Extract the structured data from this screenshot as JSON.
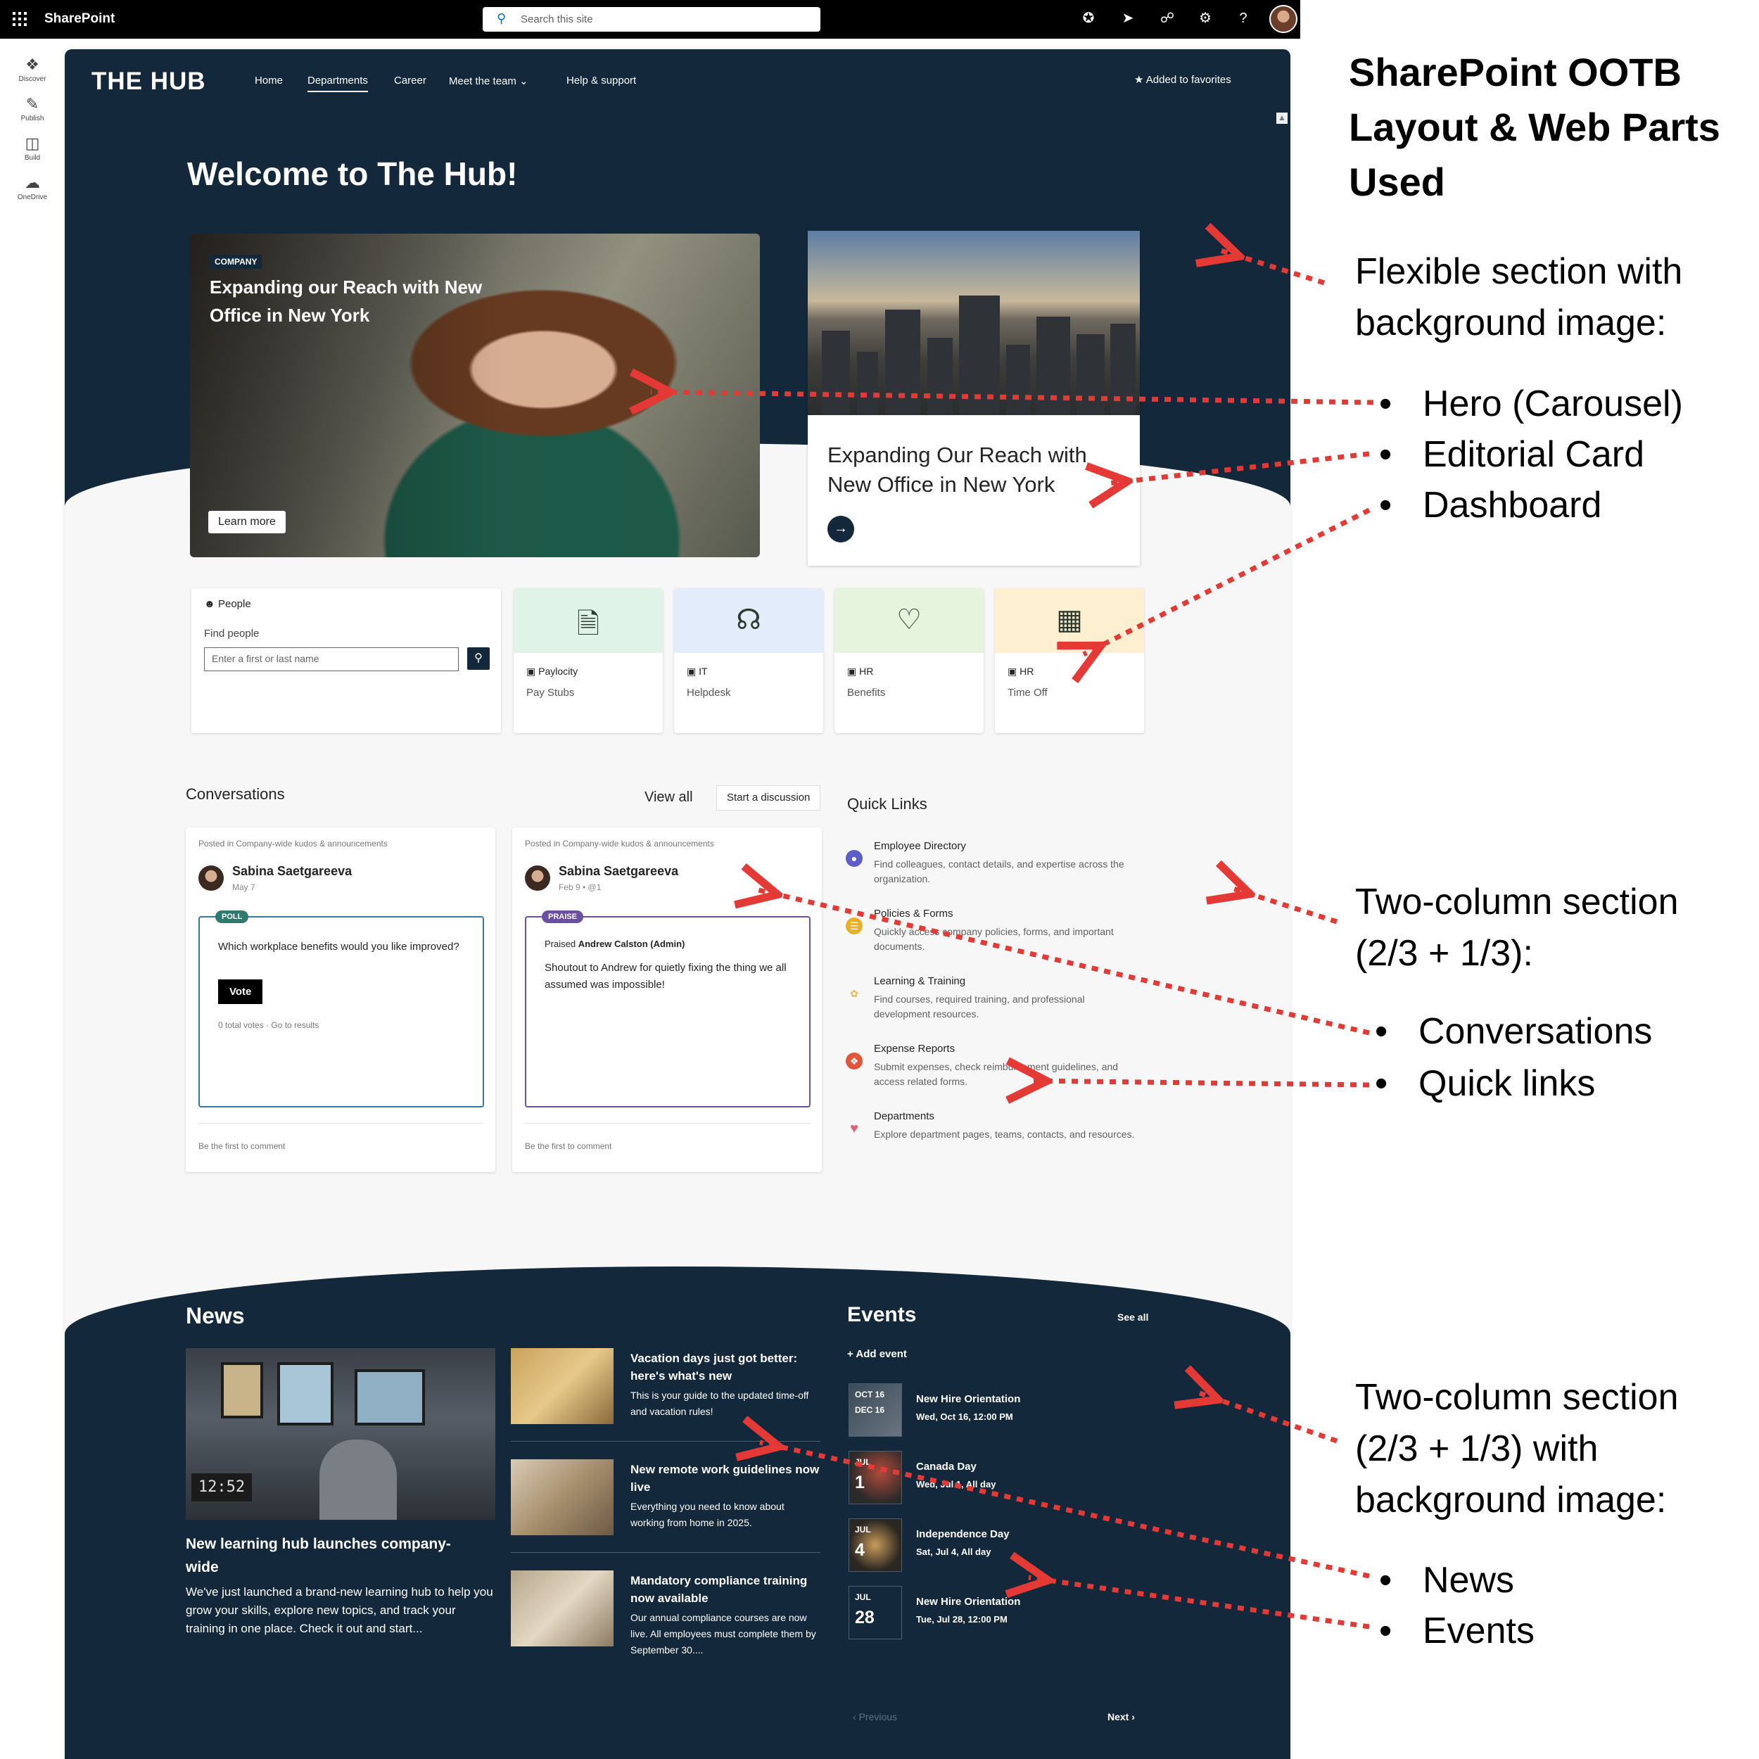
{
  "suitebar": {
    "app_name": "SharePoint",
    "search_placeholder": "Search this site",
    "icons": [
      "copilot-icon",
      "megaphone-icon",
      "share-icon",
      "settings-icon",
      "help-icon"
    ],
    "help_glyph": "?"
  },
  "apprail": {
    "items": [
      {
        "label": "Discover",
        "icon": "compass-icon"
      },
      {
        "label": "Publish",
        "icon": "pen-icon"
      },
      {
        "label": "Build",
        "icon": "layout-icon"
      },
      {
        "label": "OneDrive",
        "icon": "cloud-icon"
      }
    ]
  },
  "site": {
    "logo": "THE HUB",
    "nav": [
      "Home",
      "Departments",
      "Career",
      "Meet the team",
      "Help & support"
    ],
    "nav_active": "Departments",
    "favorites": "Added to favorites",
    "welcome": "Welcome to The Hub!"
  },
  "hero": {
    "tag": "COMPANY",
    "title": "Expanding our Reach with New Office in New York",
    "button": "Learn more"
  },
  "editorial": {
    "title": "Expanding Our Reach with New Office in New York"
  },
  "dashboard": {
    "people": {
      "header": "People",
      "find_label": "Find people",
      "input_placeholder": "Enter a first or last name"
    },
    "tiles": [
      {
        "source": "Paylocity",
        "name": "Pay Stubs",
        "icon": "dollar-document-icon",
        "color": "#dff3e6"
      },
      {
        "source": "IT",
        "name": "Helpdesk",
        "icon": "headset-icon",
        "color": "#e3ecfa"
      },
      {
        "source": "HR",
        "name": "Benefits",
        "icon": "heart-icon",
        "color": "#e6f4dd"
      },
      {
        "source": "HR",
        "name": "Time Off",
        "icon": "calendar-icon",
        "color": "#fdf0d0"
      }
    ]
  },
  "conversations": {
    "title": "Conversations",
    "view_all": "View all",
    "start": "Start a discussion",
    "posts": [
      {
        "posted_in": "Posted in Company-wide kudos & announcements",
        "author": "Sabina Saetgareeva",
        "date": "May 7",
        "badge": "POLL",
        "badge_color": "#2f7a6f",
        "question": "Which workplace benefits would you like improved?",
        "vote": "Vote",
        "results": "0 total votes · Go to results",
        "comment": "Be the first to comment"
      },
      {
        "posted_in": "Posted in Company-wide kudos & announcements",
        "author": "Sabina Saetgareeva",
        "date": "Feb 9  •  @1",
        "badge": "PRAISE",
        "badge_color": "#6b4fa0",
        "praised_prefix": "Praised",
        "praised_name": "Andrew Calston (Admin)",
        "message": "Shoutout to Andrew for quietly fixing the thing we all assumed was impossible!",
        "comment": "Be the first to comment"
      }
    ]
  },
  "quick_links": {
    "title": "Quick Links",
    "items": [
      {
        "name": "Employee Directory",
        "desc": "Find colleagues, contact details, and expertise across the organization.",
        "icon": "person-icon",
        "color": "#5b5fc7"
      },
      {
        "name": "Policies & Forms",
        "desc": "Quickly access company policies, forms, and important documents.",
        "icon": "document-icon",
        "color": "#e8b02a"
      },
      {
        "name": "Learning & Training",
        "desc": "Find courses, required training, and professional development resources.",
        "icon": "leaf-icon",
        "color": "#e8b94a"
      },
      {
        "name": "Expense Reports",
        "desc": "Submit expenses, check reimbursement guidelines, and access related forms.",
        "icon": "lifebuoy-icon",
        "color": "#e2553b"
      },
      {
        "name": "Departments",
        "desc": "Explore department pages, teams, contacts, and resources.",
        "icon": "heart-icon",
        "color": "#e0607a"
      }
    ]
  },
  "news": {
    "title": "News",
    "main": {
      "title": "New learning hub launches company-wide",
      "desc": "We've just launched a brand-new learning hub to help you grow your skills, explore new topics, and track your training in one place. Check it out and start...",
      "clock": "12:52"
    },
    "items": [
      {
        "title": "Vacation days just got better: here's what's new",
        "desc": "This is your guide to the updated time-off and vacation rules!"
      },
      {
        "title": "New remote work guidelines now live",
        "desc": "Everything you need to know about working from home in 2025."
      },
      {
        "title": "Mandatory compliance training now available",
        "desc": "Our annual compliance courses are now live. All employees must complete them by September 30...."
      }
    ]
  },
  "events": {
    "title": "Events",
    "see_all": "See all",
    "add": "Add event",
    "items": [
      {
        "month": "OCT 16",
        "day": "DEC 16",
        "name": "New Hire Orientation",
        "when": "Wed, Oct 16, 12:00 PM"
      },
      {
        "month": "JUL",
        "day": "1",
        "name": "Canada Day",
        "when": "Wed, Jul 1, All day"
      },
      {
        "month": "JUL",
        "day": "4",
        "name": "Independence Day",
        "when": "Sat, Jul 4, All day"
      },
      {
        "month": "JUL",
        "day": "28",
        "name": "New Hire Orientation",
        "when": "Tue, Jul 28, 12:00 PM"
      }
    ],
    "prev": "Previous",
    "next": "Next"
  },
  "annotations": {
    "heading": "SharePoint OOTB Layout & Web Parts Used",
    "section1": "Flexible section with background image:",
    "section1_items": [
      "Hero (Carousel)",
      "Editorial Card",
      "Dashboard"
    ],
    "section2": "Two-column section (2/3 + 1/3):",
    "section2_items": [
      "Conversations",
      "Quick links"
    ],
    "section3": "Two-column section (2/3 + 1/3) with background image:",
    "section3_items": [
      "News",
      "Events"
    ],
    "arrow_color": "#e53935"
  }
}
